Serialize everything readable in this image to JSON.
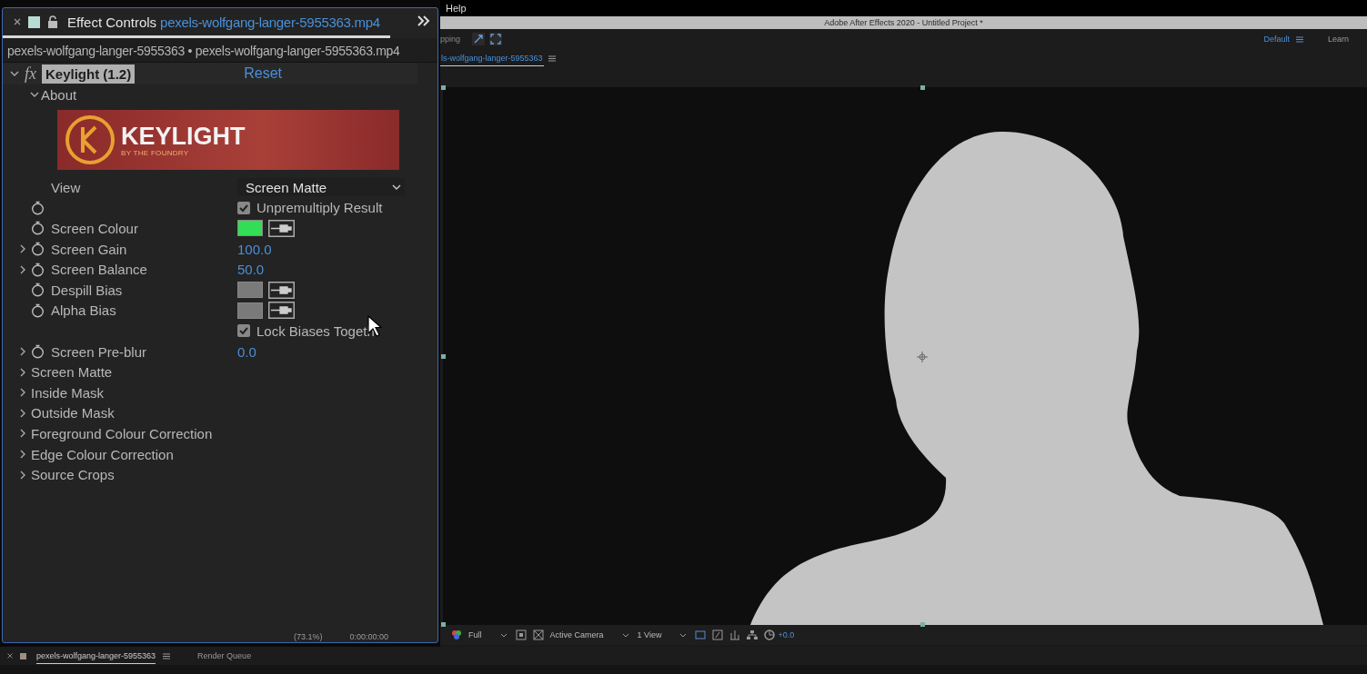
{
  "menu": {
    "items": [
      "Help"
    ]
  },
  "app_title": "Adobe After Effects 2020 - Untitled Project *",
  "toolbar": {
    "snapping_label": "pping",
    "workspaces": [
      {
        "label": "Default",
        "selected": true
      },
      {
        "label": "Learn",
        "selected": false
      }
    ]
  },
  "effect_controls": {
    "title": "Effect Controls",
    "file": "pexels-wolfgang-langer-5955363.mp4",
    "breadcrumb": "pexels-wolfgang-langer-5955363 • pexels-wolfgang-langer-5955363.mp4",
    "effect": {
      "icon_text": "fx",
      "name": "Keylight (1.2)",
      "expanded": true,
      "reset": "Reset"
    },
    "about": {
      "label": "About",
      "expanded": true,
      "logo_text": "KEYLIGHT",
      "logo_subtext": "BY THE FOUNDRY"
    },
    "rows": [
      {
        "kind": "dropdown",
        "label": "View",
        "stopwatch": false,
        "value": "Screen Matte"
      },
      {
        "kind": "checkbox",
        "label": "",
        "stopwatch": true,
        "value": "Unpremultiply Result",
        "checked": true
      },
      {
        "kind": "color",
        "label": "Screen Colour",
        "stopwatch": true,
        "color": "#33dd55"
      },
      {
        "kind": "number",
        "label": "Screen Gain",
        "stopwatch": true,
        "expanded": false,
        "value": "100.0"
      },
      {
        "kind": "number",
        "label": "Screen Balance",
        "stopwatch": true,
        "expanded": false,
        "value": "50.0"
      },
      {
        "kind": "color",
        "label": "Despill Bias",
        "stopwatch": true,
        "color": "#7a7a7a"
      },
      {
        "kind": "color",
        "label": "Alpha Bias",
        "stopwatch": true,
        "color": "#7a7a7a"
      },
      {
        "kind": "checkbox",
        "label": "",
        "stopwatch": false,
        "value": "Lock Biases Togeth",
        "checked": true
      },
      {
        "kind": "number",
        "label": "Screen Pre-blur",
        "stopwatch": true,
        "expanded": false,
        "value": "0.0"
      },
      {
        "kind": "group",
        "label": "Screen Matte",
        "expanded": false
      },
      {
        "kind": "group",
        "label": "Inside Mask",
        "expanded": false
      },
      {
        "kind": "group",
        "label": "Outside Mask",
        "expanded": false
      },
      {
        "kind": "group",
        "label": "Foreground Colour Correction",
        "expanded": false
      },
      {
        "kind": "group",
        "label": "Edge Colour Correction",
        "expanded": false
      },
      {
        "kind": "group",
        "label": "Source Crops",
        "expanded": false
      }
    ],
    "footer": [
      "(73.1%)",
      "0:00:00:00"
    ]
  },
  "composition_tab": {
    "label": "ls-wolfgang-langer-5955363",
    "selected": true
  },
  "viewer_bar": {
    "resolution": "Full",
    "camera": "Active Camera",
    "views": "1 View",
    "exposure": "+0.0"
  },
  "bottom_tabs": [
    {
      "label": "pexels-wolfgang-langer-5955363",
      "selected": true
    },
    {
      "label": "Render Queue",
      "selected": false
    }
  ]
}
